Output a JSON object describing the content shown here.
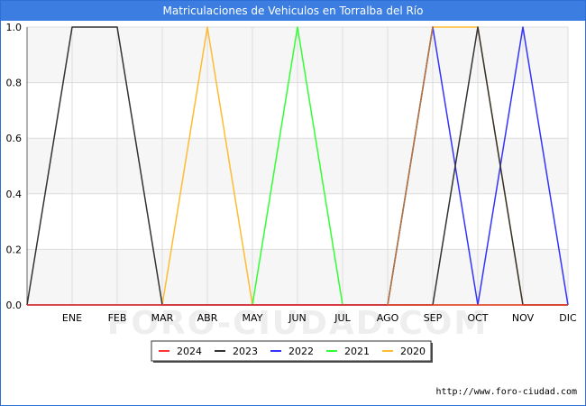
{
  "chart_data": {
    "type": "line",
    "title": "Matriculaciones de Vehiculos en Torralba del Río",
    "categories": [
      "",
      "ENE",
      "FEB",
      "MAR",
      "ABR",
      "MAY",
      "JUN",
      "JUL",
      "AGO",
      "SEP",
      "OCT",
      "NOV",
      "DIC"
    ],
    "y_ticks": [
      "0.0",
      "0.2",
      "0.4",
      "0.6",
      "0.8",
      "1.0"
    ],
    "ylim": [
      0,
      1
    ],
    "grid": true,
    "legend_position": "bottom-center",
    "series": [
      {
        "name": "2024",
        "color": "#ff3333",
        "values": [
          0,
          0,
          0,
          0,
          0,
          0,
          0,
          0,
          0,
          0,
          0,
          0,
          0
        ]
      },
      {
        "name": "2023",
        "color": "#333333",
        "values": [
          0,
          1,
          1,
          0,
          0,
          0,
          0,
          0,
          0,
          0,
          1,
          0,
          0
        ]
      },
      {
        "name": "2022",
        "color": "#3333ff",
        "values": [
          0,
          0,
          0,
          0,
          0,
          0,
          0,
          0,
          0,
          1,
          0,
          1,
          0
        ]
      },
      {
        "name": "2021",
        "color": "#33ff33",
        "values": [
          0,
          0,
          0,
          0,
          0,
          0,
          1,
          0,
          0,
          0,
          0,
          0,
          0
        ]
      },
      {
        "name": "2020",
        "color": "#ffbb33",
        "values": [
          0,
          0,
          0,
          0,
          1,
          0,
          0,
          0,
          0,
          1,
          1,
          0,
          0
        ]
      }
    ],
    "overlap_color": "#b5743a",
    "source": "http://www.foro-ciudad.com",
    "watermark": "FORO-CIUDAD.COM"
  }
}
